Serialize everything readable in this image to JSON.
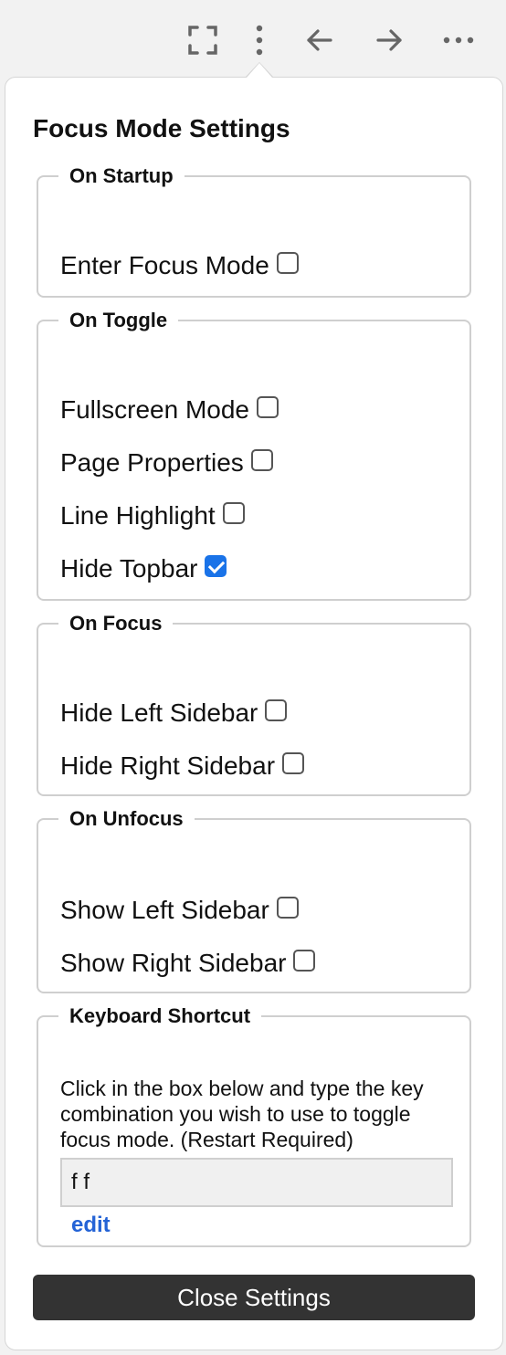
{
  "toolbar": {
    "icons": [
      "fullscreen-icon",
      "vertical-ellipsis-icon",
      "back-arrow-icon",
      "forward-arrow-icon",
      "horizontal-ellipsis-icon"
    ],
    "icon_color": "#666666"
  },
  "panel": {
    "title": "Focus Mode Settings",
    "groups": [
      {
        "legend": "On Startup",
        "options": [
          {
            "label": "Enter Focus Mode",
            "checked": false
          }
        ]
      },
      {
        "legend": "On Toggle",
        "options": [
          {
            "label": "Fullscreen Mode",
            "checked": false
          },
          {
            "label": "Page Properties",
            "checked": false
          },
          {
            "label": "Line Highlight",
            "checked": false
          },
          {
            "label": "Hide Topbar",
            "checked": true
          }
        ]
      },
      {
        "legend": "On Focus",
        "options": [
          {
            "label": "Hide Left Sidebar",
            "checked": false
          },
          {
            "label": "Hide Right Sidebar",
            "checked": false
          }
        ]
      },
      {
        "legend": "On Unfocus",
        "options": [
          {
            "label": "Show Left Sidebar",
            "checked": false
          },
          {
            "label": "Show Right Sidebar",
            "checked": false
          }
        ]
      }
    ],
    "shortcut": {
      "legend": "Keyboard Shortcut",
      "description": "Click in the box below and type the key combination you wish to use to toggle focus mode. (Restart Required)",
      "value": "f f",
      "edit_label": "edit"
    },
    "close_label": "Close Settings"
  },
  "colors": {
    "accent": "#1a73e8",
    "link": "#2463d6",
    "close_button_bg": "#333333"
  }
}
